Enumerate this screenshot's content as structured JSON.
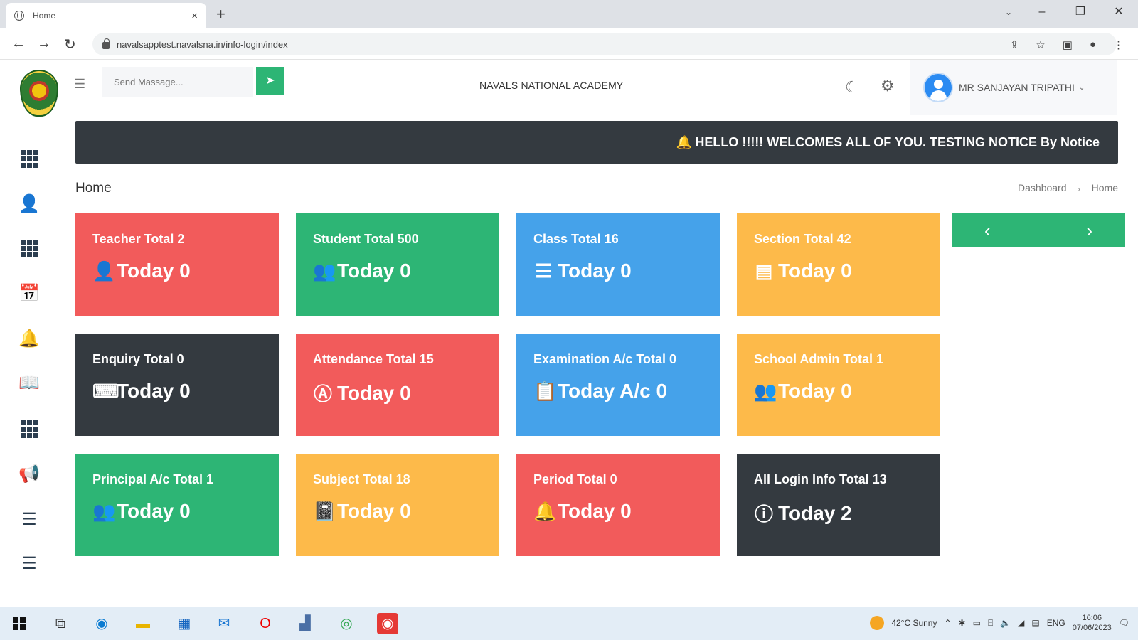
{
  "browser": {
    "tab_title": "Home",
    "tab_close": "×",
    "new_tab": "+",
    "url": "navalsapptest.navalsna.in/info-login/index",
    "window_controls": {
      "dropdown": "⌄",
      "minimize": "–",
      "restore": "❐",
      "close": "✕"
    }
  },
  "header": {
    "message_placeholder": "Send Massage...",
    "academy_name": "NAVALS NATIONAL ACADEMY",
    "user_name": "MR SANJAYAN TRIPATHI"
  },
  "notice": {
    "text": "HELLO !!!!! WELCOMES ALL OF YOU. TESTING NOTICE By Notice"
  },
  "page": {
    "title": "Home",
    "breadcrumb": [
      "Dashboard",
      "Home"
    ]
  },
  "cards": [
    {
      "title": "Teacher Total 2",
      "today": "Today 0",
      "icon": "teacher-icon",
      "color": "#f25b5b"
    },
    {
      "title": "Student Total 500",
      "today": "Today 0",
      "icon": "students-icon",
      "color": "#2db575"
    },
    {
      "title": "Class Total 16",
      "today": "Today 0",
      "icon": "list-icon",
      "color": "#45a2ea"
    },
    {
      "title": "Section Total 42",
      "today": "Today 0",
      "icon": "section-list-icon",
      "color": "#fdba4a"
    },
    {
      "title": "Enquiry Total 0",
      "today": "Today 0",
      "icon": "keyboard-icon",
      "color": "#343a40"
    },
    {
      "title": "Attendance Total 15",
      "today": "Today 0",
      "icon": "attendance-icon",
      "color": "#f25b5b"
    },
    {
      "title": "Examination A/c Total 0",
      "today": "Today A/c 0",
      "icon": "clipboard-icon",
      "color": "#45a2ea"
    },
    {
      "title": "School Admin Total 1",
      "today": "Today 0",
      "icon": "admin-icon",
      "color": "#fdba4a"
    },
    {
      "title": "Principal A/c Total 1",
      "today": "Today 0",
      "icon": "principal-icon",
      "color": "#2db575"
    },
    {
      "title": "Subject Total 18",
      "today": "Today 0",
      "icon": "book-icon",
      "color": "#fdba4a"
    },
    {
      "title": "Period Total 0",
      "today": "Today 0",
      "icon": "bell-icon",
      "color": "#f25b5b"
    },
    {
      "title": "All Login Info Total 13",
      "today": "Today 2",
      "icon": "info-icon",
      "color": "#343a40"
    }
  ],
  "sidebar_icons": [
    "apps-icon",
    "user-icon",
    "apps-icon",
    "calendar-icon",
    "bell-icon",
    "book-icon",
    "apps-icon",
    "megaphone-icon",
    "indent-icon",
    "indent-icon"
  ],
  "taskbar": {
    "weather": "42°C  Sunny",
    "language": "ENG",
    "time": "16:06",
    "date": "07/06/2023"
  }
}
